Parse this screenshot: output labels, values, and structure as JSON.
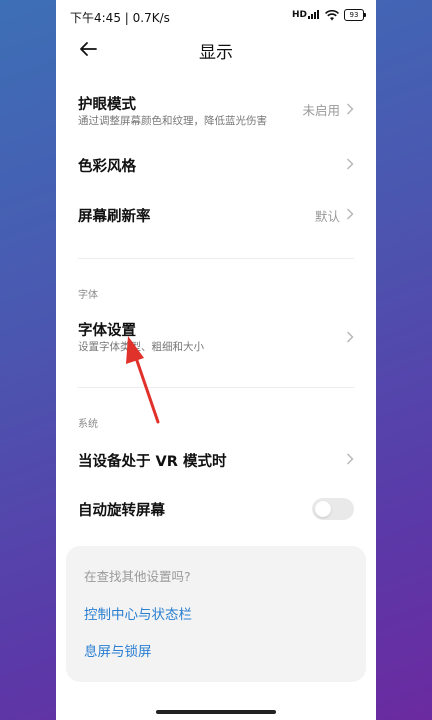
{
  "status_bar": {
    "time": "下午4:45 | 0.7K/s",
    "signal": "HD",
    "battery": "93"
  },
  "header": {
    "title": "显示"
  },
  "items": {
    "eye_care": {
      "title": "护眼模式",
      "subtitle": "通过调整屏幕颜色和纹理，降低蓝光伤害",
      "value": "未启用"
    },
    "color_style": {
      "title": "色彩风格"
    },
    "refresh_rate": {
      "title": "屏幕刷新率",
      "value": "默认"
    },
    "font_settings": {
      "title": "字体设置",
      "subtitle": "设置字体类型、粗细和大小"
    },
    "vr_mode": {
      "title": "当设备处于 VR 模式时"
    },
    "auto_rotate": {
      "title": "自动旋转屏幕",
      "enabled": false
    }
  },
  "sections": {
    "font": "字体",
    "system": "系统"
  },
  "suggest": {
    "title": "在查找其他设置吗?",
    "links": [
      "控制中心与状态栏",
      "息屏与锁屏"
    ]
  },
  "colors": {
    "link": "#2a7fd1",
    "annotation": "#e0312a"
  }
}
